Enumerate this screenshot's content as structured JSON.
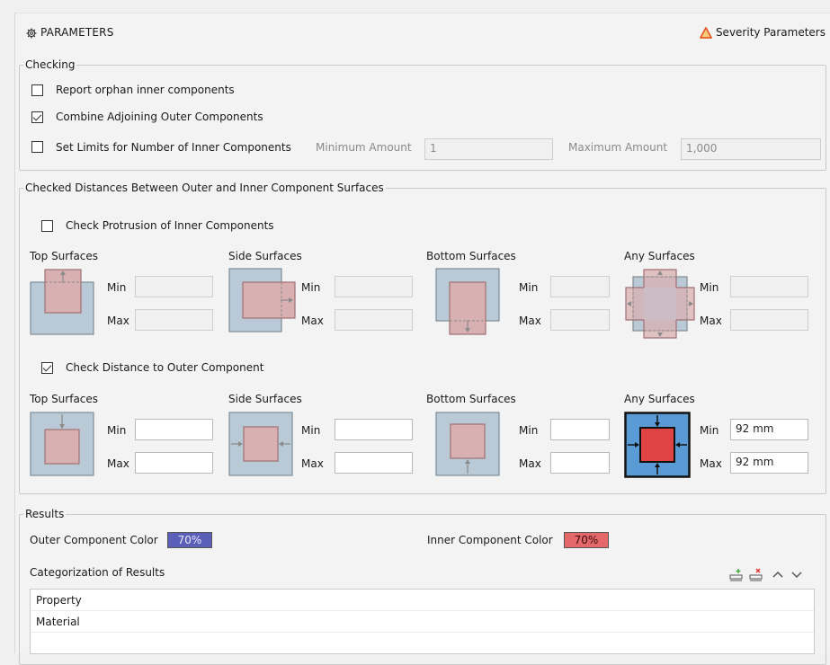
{
  "header": {
    "title": "PARAMETERS",
    "severity_label": "Severity Parameters"
  },
  "checking": {
    "legend": "Checking",
    "report_orphan": {
      "label": "Report orphan inner components",
      "checked": false
    },
    "combine_adjoining": {
      "label": "Combine Adjoining Outer Components",
      "checked": true
    },
    "set_limits": {
      "label": "Set Limits for Number of Inner Components",
      "checked": false
    },
    "min_amount_label": "Minimum Amount",
    "min_amount_value": "1",
    "max_amount_label": "Maximum Amount",
    "max_amount_value": "1,000"
  },
  "distances": {
    "legend": "Checked Distances Between Outer and Inner Component Surfaces",
    "protrusion": {
      "label": "Check Protrusion of Inner Components",
      "checked": false
    },
    "distance": {
      "label": "Check Distance to Outer Component",
      "checked": true
    },
    "surfaces": [
      "Top Surfaces",
      "Side Surfaces",
      "Bottom Surfaces",
      "Any Surfaces"
    ],
    "min_label": "Min",
    "max_label": "Max",
    "any_min_value": "92 mm",
    "any_max_value": "92 mm"
  },
  "results": {
    "legend": "Results",
    "outer_color_label": "Outer Component Color",
    "outer_color_value": "70%",
    "outer_color_hex": "#5b5fb8",
    "inner_color_label": "Inner Component Color",
    "inner_color_value": "70%",
    "inner_color_hex": "#e4676a",
    "categorization_label": "Categorization of Results",
    "rows": [
      "Property",
      "Material"
    ]
  },
  "icons": {
    "title_icon": "gear-icon",
    "severity_icon": "warning-triangle-icon",
    "add_icon": "add-row-icon",
    "remove_icon": "remove-row-icon",
    "up_icon": "chevron-up-icon",
    "down_icon": "chevron-down-icon"
  }
}
